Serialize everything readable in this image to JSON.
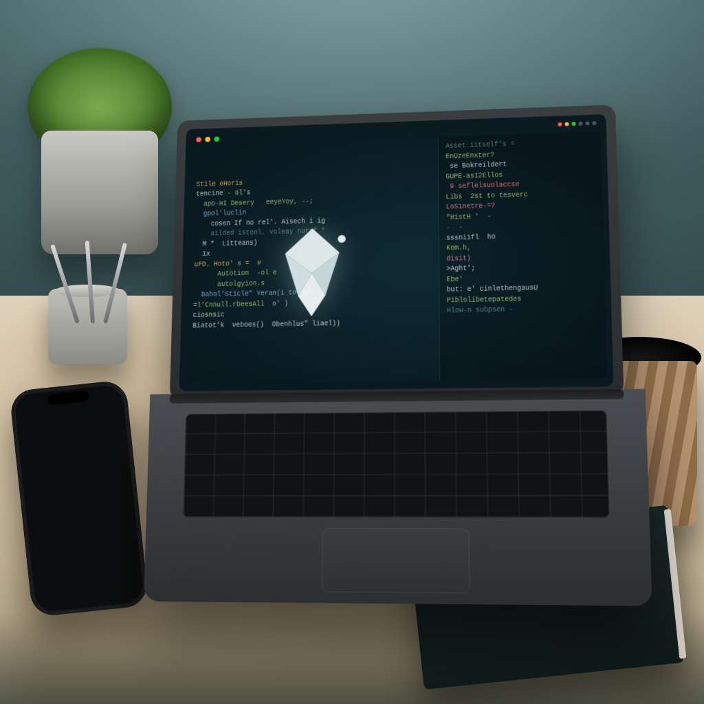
{
  "scene": {
    "description": "Photograph-style render of a laptop on a wooden desk showing a dark code editor with two panes and a geometric white logo watermark. Surrounding props: potted succulent, pen cup, smartphone, takeaway coffee cup, closed notebook with stylus.",
    "props": [
      "succulent-plant",
      "pen-cup",
      "smartphone",
      "coffee-cup",
      "notebook",
      "stylus"
    ]
  },
  "colors": {
    "wall": "#5f7d80",
    "desk": "#cdbb9b",
    "editor_bg": "#0a1b22",
    "keyword": "#c9a15a",
    "function": "#8fb573",
    "string": "#7aa6c2",
    "comment": "#567b7e",
    "number": "#c97a8a",
    "identifier": "#b8c2c4",
    "error": "#e06c75"
  },
  "editor": {
    "window_controls": [
      "close",
      "minimize",
      "zoom"
    ],
    "logo_name": "origami-bird-logo",
    "left_pane": {
      "label": "source-editor",
      "lines": [
        {
          "cls": "kw",
          "text": "Stile eHoris"
        },
        {
          "cls": "id",
          "text": "tencine - ol's"
        },
        {
          "cls": "fn",
          "text": "  apo-HI Desery   eeyeYoy, --;"
        },
        {
          "cls": "str",
          "text": "  gpol'luclin"
        },
        {
          "cls": "id",
          "text": "    cosen If no rel'. Aisech i ig"
        },
        {
          "cls": "com",
          "text": "    ailded istenl. voleay nuref *"
        },
        {
          "cls": "id",
          "text": "  M *  Litteans)"
        },
        {
          "cls": "id",
          "text": "  1x"
        },
        {
          "cls": "id",
          "text": ""
        },
        {
          "cls": "kw",
          "text": "uFO. Hoto' s =  #"
        },
        {
          "cls": "fn",
          "text": "      Autotion  -ol e"
        },
        {
          "cls": "fn",
          "text": "      autolgyion.s"
        },
        {
          "cls": "str",
          "text": "  bahol'Sticle\" Yeran(i to 1wSly)"
        },
        {
          "cls": "id",
          "text": ""
        },
        {
          "cls": "fn",
          "text": "=l'Cnnull.rbeesAll  o' )"
        },
        {
          "cls": "id",
          "text": "ciosnsic"
        },
        {
          "cls": "id",
          "text": ""
        },
        {
          "cls": "id",
          "text": "Biatot'k  veboes()  Obenhlus\" liael))"
        }
      ]
    },
    "right_pane": {
      "label": "terminal-output",
      "lines": [
        {
          "cls": "com",
          "text": "Asset iitself's = "
        },
        {
          "cls": "fn",
          "text": "EnUzeEnxter?"
        },
        {
          "cls": "id",
          "text": " se Bokreildert"
        },
        {
          "cls": "fn",
          "text": "GUPE-as12Ellos"
        },
        {
          "cls": "err",
          "text": " 9 seflelsuolaccse"
        },
        {
          "cls": "fn",
          "text": "Libs  2st to tesverc"
        },
        {
          "cls": "num",
          "text": "LoSinetre-=?"
        },
        {
          "cls": "fn",
          "text": "\"HistH '  -"
        },
        {
          "cls": "com",
          "text": "-  -"
        },
        {
          "cls": "id",
          "text": "sssniifl  ho"
        },
        {
          "cls": "fn",
          "text": "Kom.h,"
        },
        {
          "cls": "num",
          "text": "disit)"
        },
        {
          "cls": "id",
          "text": ">Aght';"
        },
        {
          "cls": "fn",
          "text": "Ebe'"
        },
        {
          "cls": "id",
          "text": "but: e' cinlethengausU"
        },
        {
          "cls": "fn",
          "text": "Piblolibetepatedes"
        },
        {
          "cls": "com",
          "text": "Hlow-n subpsen -"
        }
      ]
    }
  }
}
